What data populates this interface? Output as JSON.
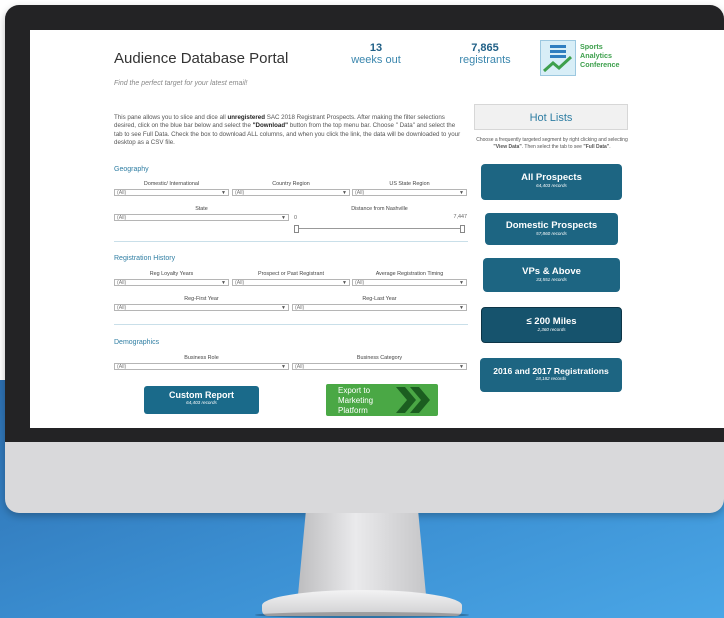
{
  "header": {
    "title": "Audience Database Portal",
    "tagline": "Find the perfect target for your latest email!",
    "kpi_weeks": {
      "value": "13",
      "label": "weeks out"
    },
    "kpi_registrants": {
      "value": "7,865",
      "label": "registrants"
    },
    "logo_text": [
      "Sports",
      "Analytics",
      "Conference"
    ]
  },
  "description": {
    "p1": "This pane allows you to slice and dice all ",
    "bold1": "unregistered",
    "p2": " SAC 2018 Registrant Prospects.  After making the filter selections desired, click on the blue bar below and select the ",
    "bold2": "\"Download\"",
    "p3": " button from the top menu bar.  Choose \" Data\" and select the tab to see Full Data. Check the box to download ALL columns, and when you click the link, the data will be downloaded to your desktop as a CSV file."
  },
  "geography": {
    "title": "Geography",
    "filters": [
      {
        "label": "Domestic/ International",
        "value": "(All)"
      },
      {
        "label": "Country Region",
        "value": "(All)"
      },
      {
        "label": "US State Region",
        "value": "(All)"
      },
      {
        "label": "State",
        "value": "(All)"
      }
    ],
    "distance": {
      "label": "Distance from Nashville",
      "min": "0",
      "max": "7,447"
    }
  },
  "registration": {
    "title": "Registration History",
    "filters": [
      {
        "label": "Reg Loyalty Years",
        "value": "(All)"
      },
      {
        "label": "Prospect or Past Registrant",
        "value": "(All)"
      },
      {
        "label": "Average Registration Timing",
        "value": "(All)"
      },
      {
        "label": "Reg-First Year",
        "value": "(All)"
      },
      {
        "label": "Reg-Last Year",
        "value": "(All)"
      }
    ]
  },
  "demographics": {
    "title": "Demographics",
    "filters": [
      {
        "label": "Business Role",
        "value": "(All)"
      },
      {
        "label": "Business Category",
        "value": "(All)"
      }
    ]
  },
  "hotlists": {
    "title": "Hot Lists",
    "desc_a": "Choose a frequently targeted segment by right clicking and selecting ",
    "desc_b": "\"View Data\"",
    "desc_c": ".  Then select the tab to see ",
    "desc_d": "\"Full Data\"",
    "desc_e": ".",
    "items": [
      {
        "label": "All Prospects",
        "records": "64,403 records"
      },
      {
        "label": "Domestic Prospects",
        "records": "57,860 records"
      },
      {
        "label": "VPs & Above",
        "records": "33,551 records"
      },
      {
        "label": "≤ 200 Miles",
        "records": "2,360 records"
      },
      {
        "label": "2016 and 2017 Registrations",
        "records": "18,182 records"
      }
    ]
  },
  "actions": {
    "custom_report": {
      "label": "Custom Report",
      "records": "64,403 records"
    },
    "export": {
      "label": "Export to Marketing Platform"
    }
  }
}
